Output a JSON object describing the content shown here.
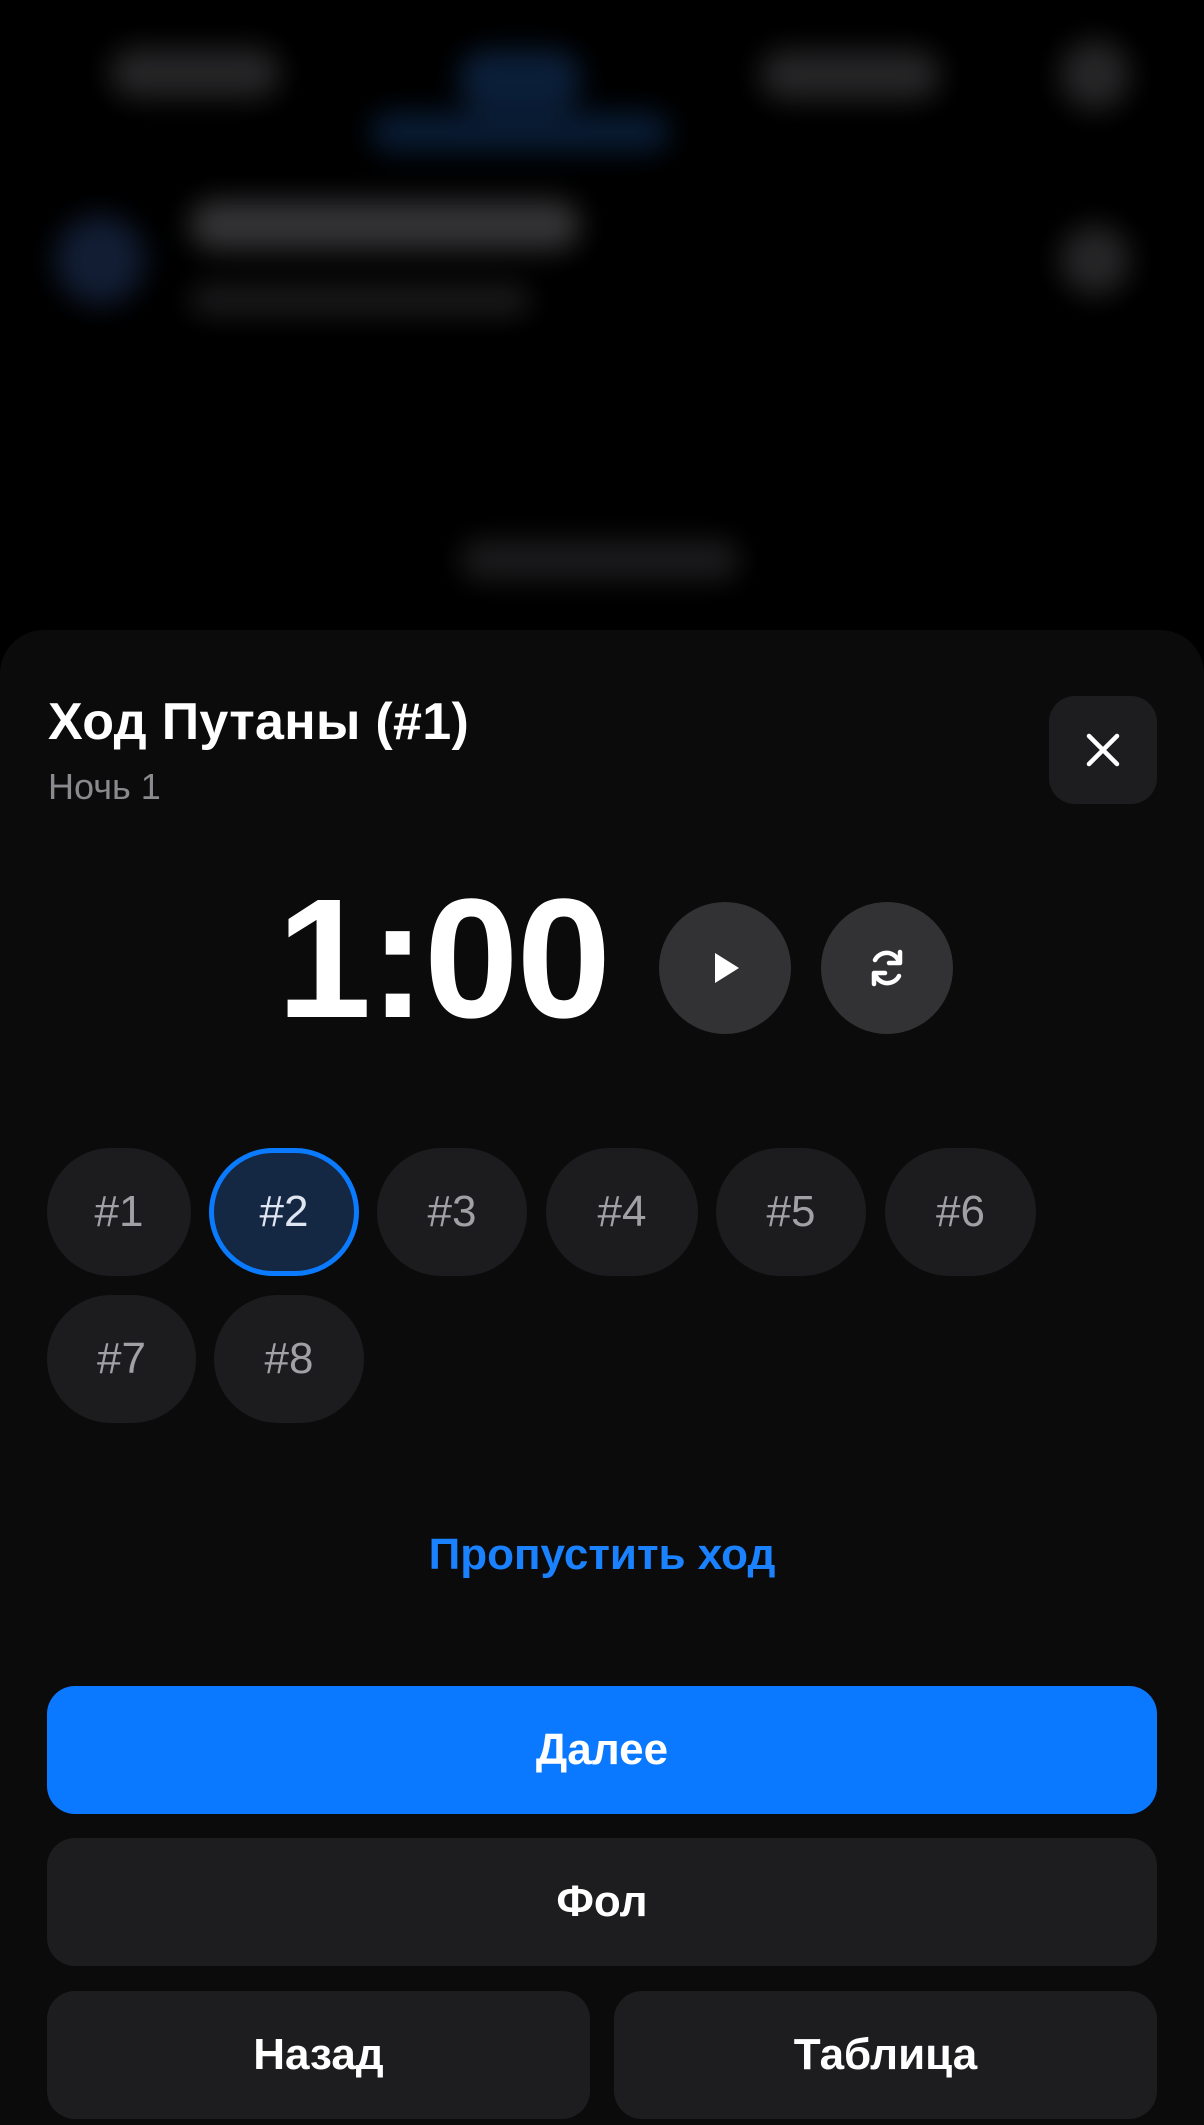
{
  "sheet": {
    "title": "Ход Путаны (#1)",
    "subtitle": "Ночь 1",
    "close_icon": "close-icon"
  },
  "timer": {
    "value": "1:00",
    "play_icon": "play-icon",
    "reset_icon": "refresh-icon"
  },
  "players": [
    {
      "label": "#1",
      "selected": false
    },
    {
      "label": "#2",
      "selected": true
    },
    {
      "label": "#3",
      "selected": false
    },
    {
      "label": "#4",
      "selected": false
    },
    {
      "label": "#5",
      "selected": false
    },
    {
      "label": "#6",
      "selected": false
    },
    {
      "label": "#7",
      "selected": false
    },
    {
      "label": "#8",
      "selected": false
    }
  ],
  "actions": {
    "skip": "Пропустить ход",
    "next": "Далее",
    "foul": "Фол",
    "back": "Назад",
    "table": "Таблица"
  },
  "colors": {
    "accent": "#0a79ff",
    "sheet_bg": "#0b0b0c",
    "chip_bg": "#1c1c1e",
    "selected_chip_bg": "#142743"
  }
}
